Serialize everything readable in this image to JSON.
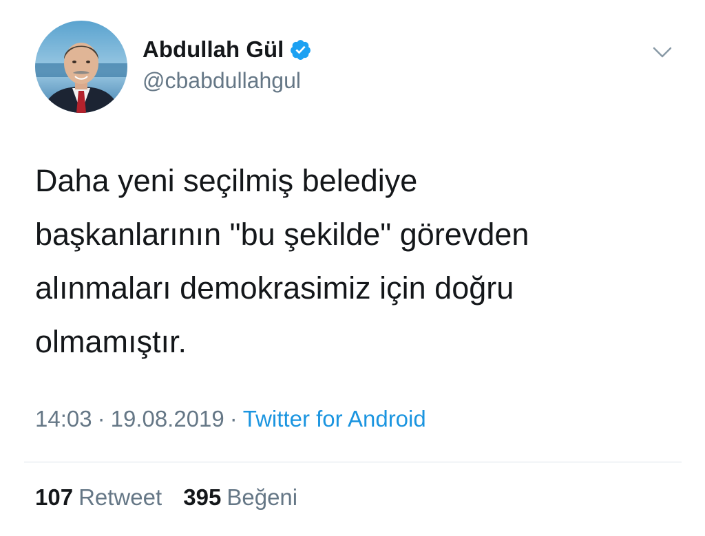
{
  "author": {
    "name": "Abdullah Gül",
    "handle": "@cbabdullahgul",
    "verified": true
  },
  "tweet": {
    "text_lines": [
      "Daha yeni seçilmiş belediye",
      "başkanlarının \"bu şekilde\" görevden",
      "alınmaları demokrasimiz için doğru",
      "olmamıştır."
    ]
  },
  "meta": {
    "time": "14:03",
    "separator": "·",
    "date": "19.08.2019",
    "source": "Twitter for Android"
  },
  "stats": {
    "retweets": {
      "count": "107",
      "label": "Retweet"
    },
    "likes": {
      "count": "395",
      "label": "Beğeni"
    }
  },
  "icons": {
    "verified": "verified-badge-icon",
    "menu": "chevron-down-icon"
  },
  "colors": {
    "primary_text": "#14171a",
    "secondary_text": "#657786",
    "link": "#1b95e0",
    "verified_badge": "#1da1f2",
    "divider": "#dbe2e8"
  }
}
